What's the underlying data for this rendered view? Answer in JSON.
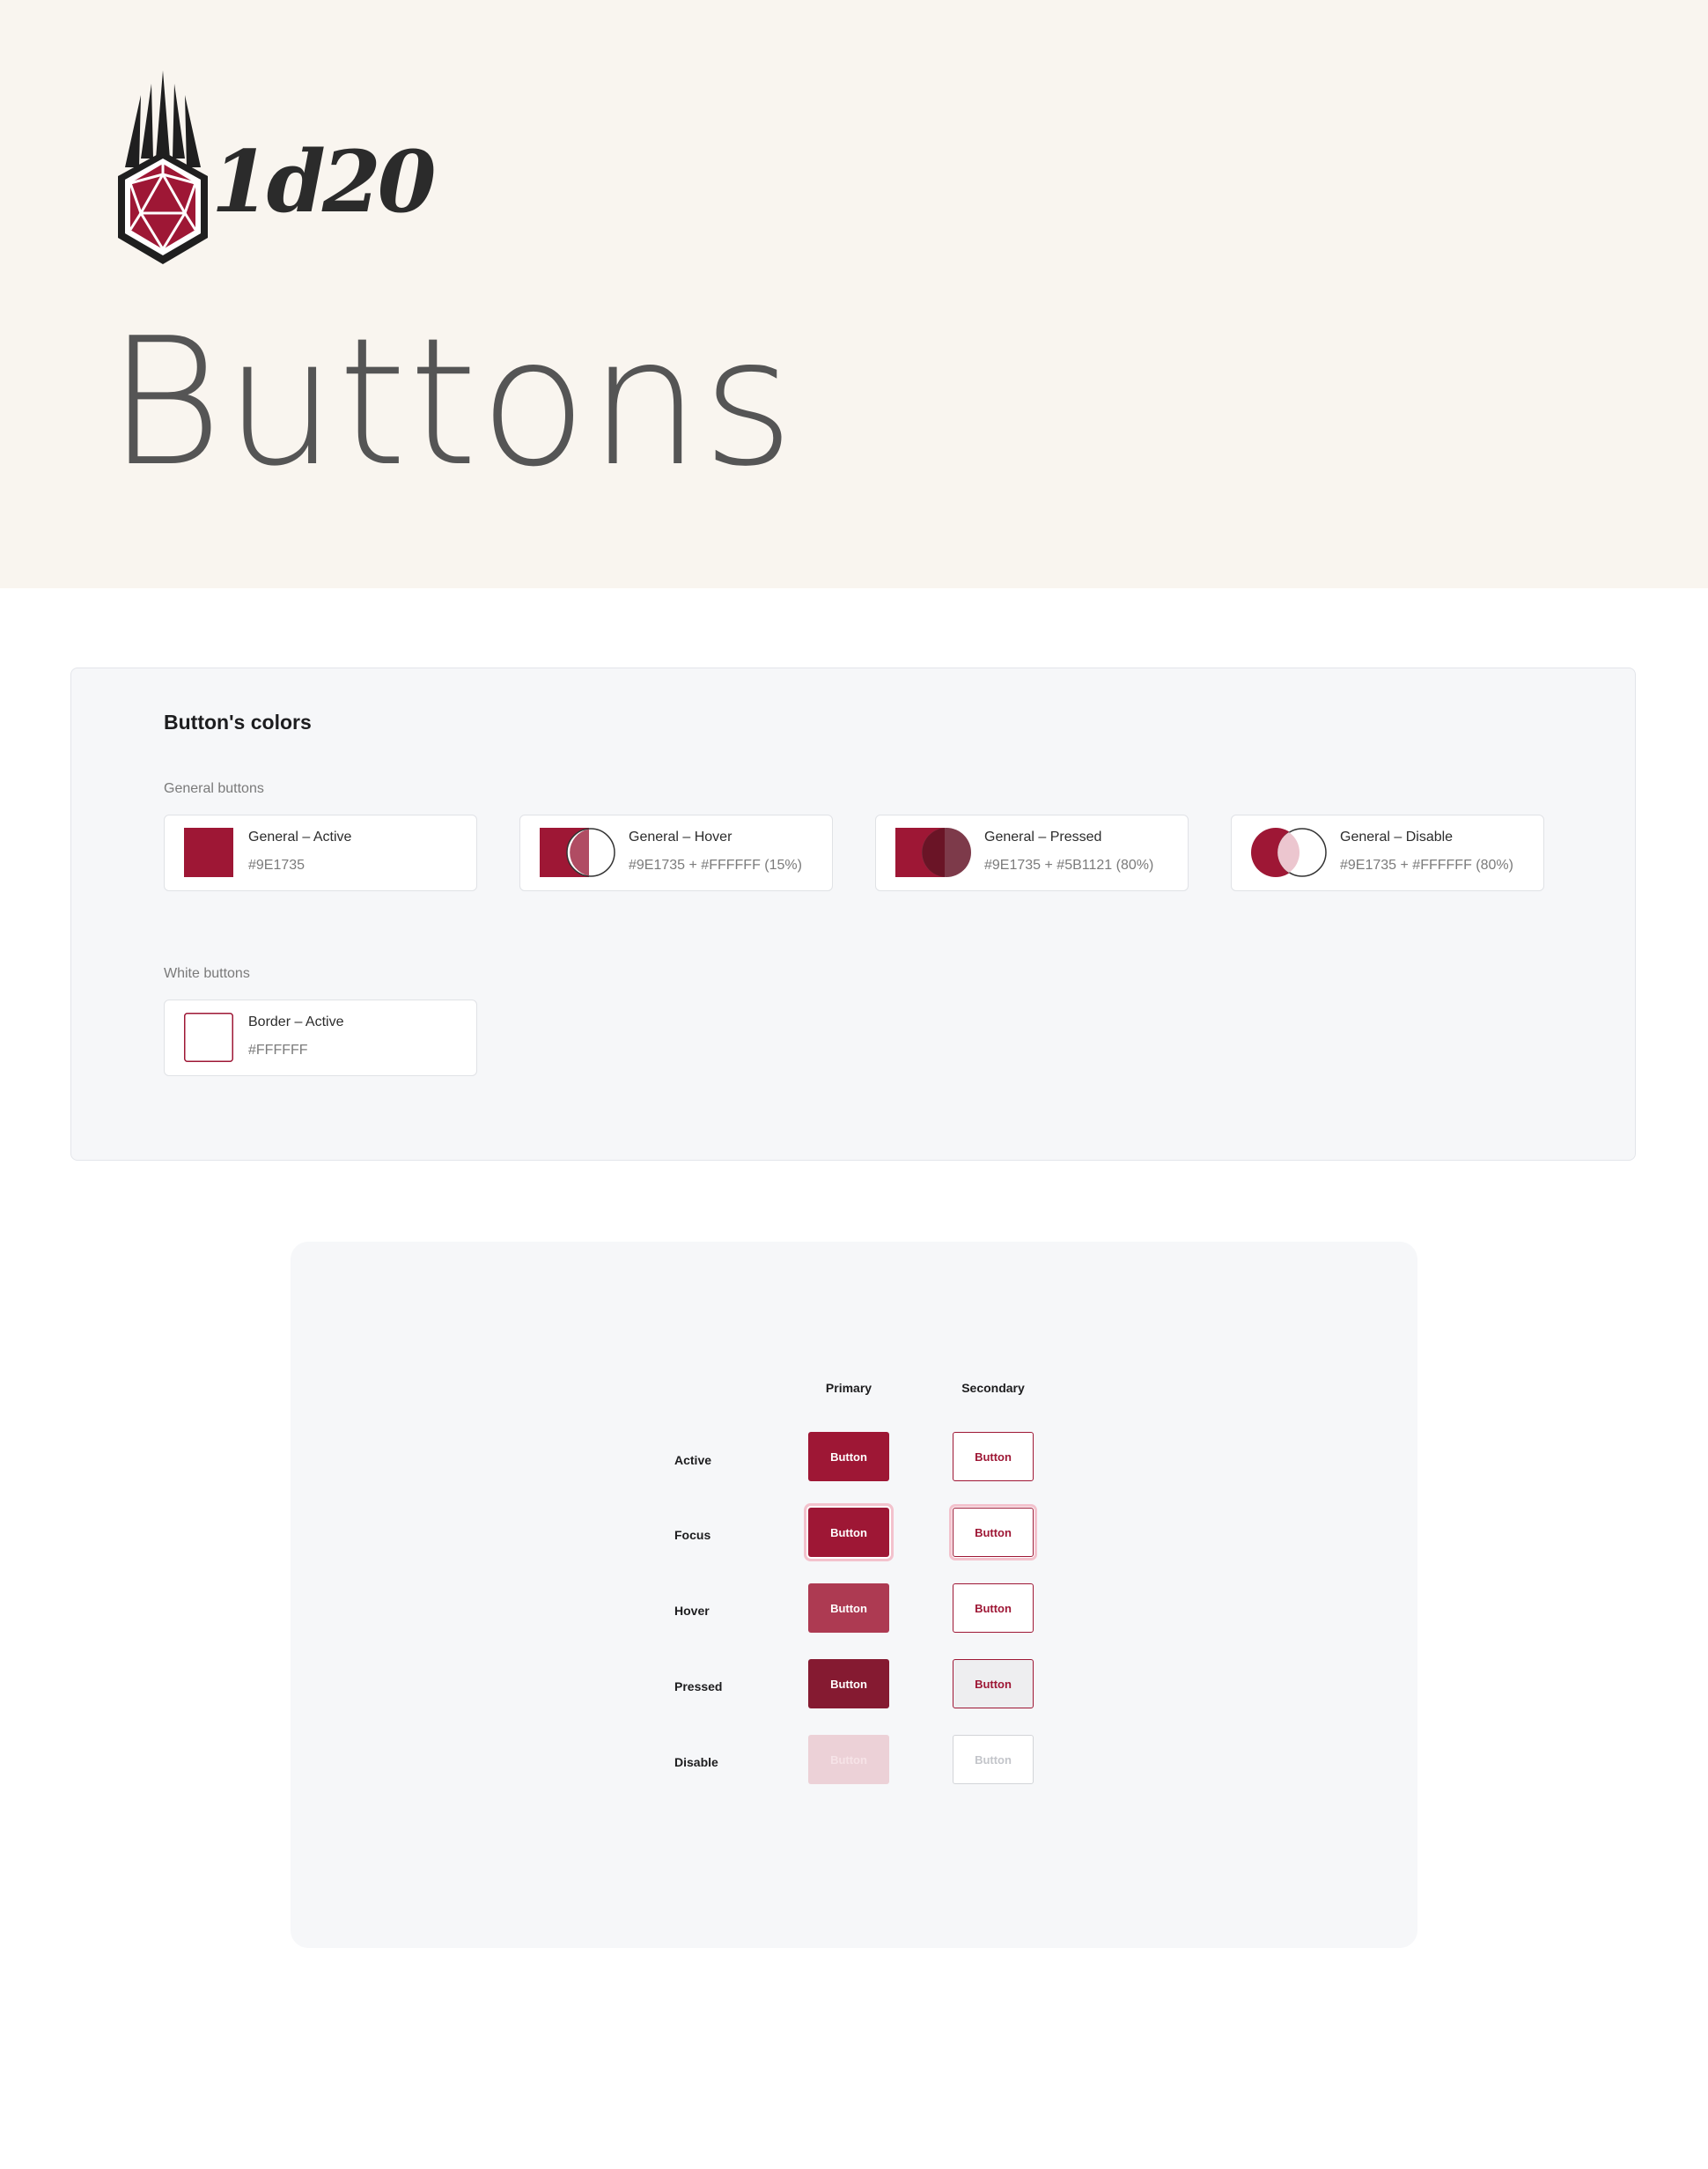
{
  "brand": {
    "logo_text": "1d20",
    "accent": "#9E1735"
  },
  "hero": {
    "title": "Buttons"
  },
  "colors_section": {
    "title": "Button's colors",
    "general_label": "General buttons",
    "white_label": "White buttons",
    "general": [
      {
        "title": "General – Active",
        "value": "#9E1735",
        "swatch": "solid"
      },
      {
        "title": "General – Hover",
        "value": "#9E1735 + #FFFFFF (15%)",
        "swatch": "hover-blend"
      },
      {
        "title": "General – Pressed",
        "value": "#9E1735 + #5B1121 (80%)",
        "swatch": "pressed-blend"
      },
      {
        "title": "General – Disable",
        "value": "#9E1735 + #FFFFFF (80%)",
        "swatch": "disable-blend"
      }
    ],
    "white": [
      {
        "title": "Border – Active",
        "value": "#FFFFFF",
        "swatch": "border"
      }
    ]
  },
  "states_section": {
    "columns": [
      "Primary",
      "Secondary"
    ],
    "rows": [
      "Active",
      "Focus",
      "Hover",
      "Pressed",
      "Disable"
    ],
    "button_label": "Button"
  }
}
